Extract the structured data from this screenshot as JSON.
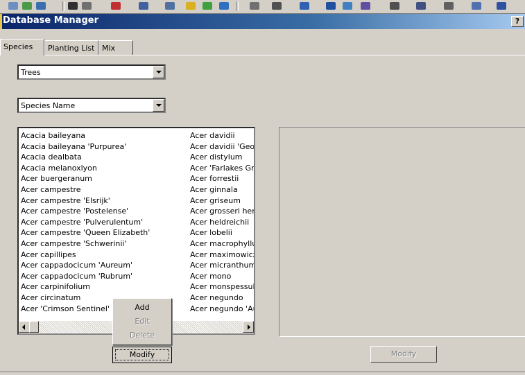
{
  "window": {
    "title": "Database Manager",
    "help_label": "?"
  },
  "tabs": [
    "Species",
    "Planting List",
    "Mix"
  ],
  "category_select": {
    "value": "Trees"
  },
  "sort_select": {
    "value": "Species Name"
  },
  "species_list": {
    "column1": [
      "Acacia baileyana",
      "Acacia baileyana 'Purpurea'",
      "Acacia dealbata",
      "Acacia melanoxlyon",
      "Acer buergeranum",
      "Acer campestre",
      "Acer campestre 'Elsrijk'",
      "Acer campestre 'Postelense'",
      "Acer campestre 'Pulverulentum'",
      "Acer campestre 'Queen Elizabeth'",
      "Acer campestre 'Schwerinii'",
      "Acer capillipes",
      "Acer cappadocicum 'Aureum'",
      "Acer cappadocicum 'Rubrum'",
      "Acer carpinifolium",
      "Acer circinatum",
      "Acer 'Crimson Sentinel'"
    ],
    "column2": [
      "Acer davidii",
      "Acer davidii 'George",
      "Acer distylum",
      "Acer 'Farlakes Greer",
      "Acer forrestii",
      "Acer ginnala",
      "Acer griseum",
      "Acer grosseri hersii",
      "Acer heldreichii",
      "Acer lobelii",
      "Acer macrophyllum",
      "Acer maximowiczii",
      "Acer micranthum",
      "Acer mono",
      "Acer monspessulanu",
      "Acer negundo",
      "Acer negundo 'Aural"
    ]
  },
  "context_menu": {
    "items": [
      "Add",
      "Edit",
      "Delete"
    ],
    "button": "Modify"
  },
  "detail": {
    "modify_label": "Modify"
  }
}
